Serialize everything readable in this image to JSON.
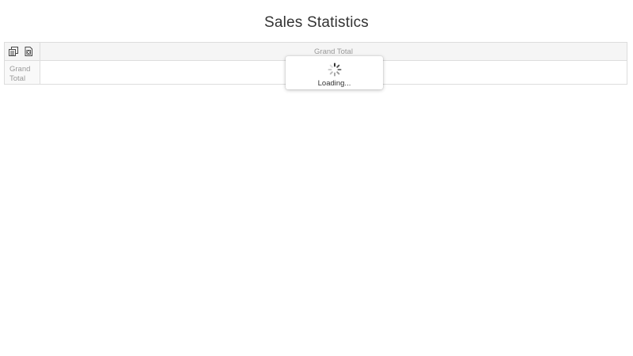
{
  "header": {
    "title": "Sales Statistics"
  },
  "pivot": {
    "column_header": "Grand Total",
    "row_header": "Grand Total"
  },
  "toolbar": {
    "field_chooser_icon": "field-chooser-icon",
    "export_icon": "excel-export-icon"
  },
  "loading": {
    "text": "Loading..."
  }
}
